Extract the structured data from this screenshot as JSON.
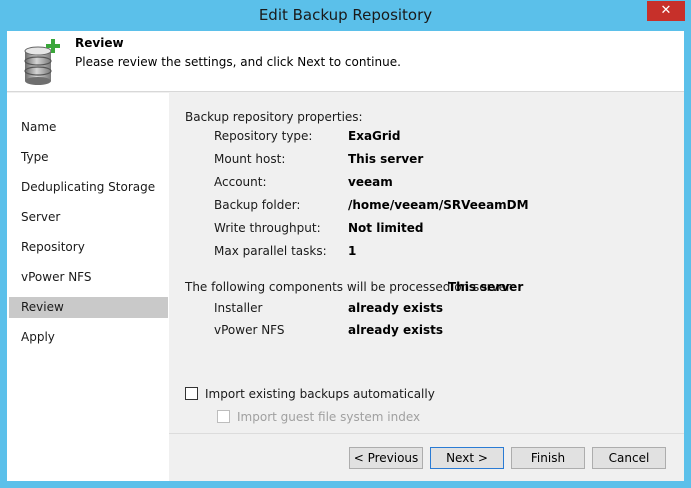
{
  "window": {
    "title": "Edit Backup Repository",
    "close_glyph": "✕"
  },
  "header": {
    "title": "Review",
    "description": "Please review the settings, and click Next to continue.",
    "icon": "database-add-icon"
  },
  "nav": {
    "items": [
      {
        "label": "Name",
        "selected": false
      },
      {
        "label": "Type",
        "selected": false
      },
      {
        "label": "Deduplicating Storage",
        "selected": false
      },
      {
        "label": "Server",
        "selected": false
      },
      {
        "label": "Repository",
        "selected": false
      },
      {
        "label": "vPower NFS",
        "selected": false
      },
      {
        "label": "Review",
        "selected": true
      },
      {
        "label": "Apply",
        "selected": false
      }
    ]
  },
  "review": {
    "properties_heading": "Backup repository properties:",
    "properties": [
      {
        "label": "Repository type:",
        "value": "ExaGrid"
      },
      {
        "label": "Mount host:",
        "value": "This server"
      },
      {
        "label": "Account:",
        "value": "veeam"
      },
      {
        "label": "Backup folder:",
        "value": "/home/veeam/SRVeeamDM"
      },
      {
        "label": "Write throughput:",
        "value": "Not limited"
      },
      {
        "label": "Max parallel tasks:",
        "value": "1"
      }
    ],
    "components_heading": "The following components will be processed on server",
    "components_server": "This server",
    "components": [
      {
        "label": "Installer",
        "value": "already exists"
      },
      {
        "label": "vPower NFS",
        "value": "already exists"
      }
    ]
  },
  "options": {
    "import_backups": {
      "label": "Import existing backups automatically",
      "checked": false,
      "enabled": true
    },
    "import_index": {
      "label": "Import guest file system index",
      "checked": false,
      "enabled": false
    }
  },
  "footer": {
    "previous": "< Previous",
    "next": "Next >",
    "finish": "Finish",
    "cancel": "Cancel"
  },
  "colors": {
    "title_bar": "#5bc0ea",
    "close_button": "#c7302a",
    "nav_selected": "#c9c9c9"
  }
}
